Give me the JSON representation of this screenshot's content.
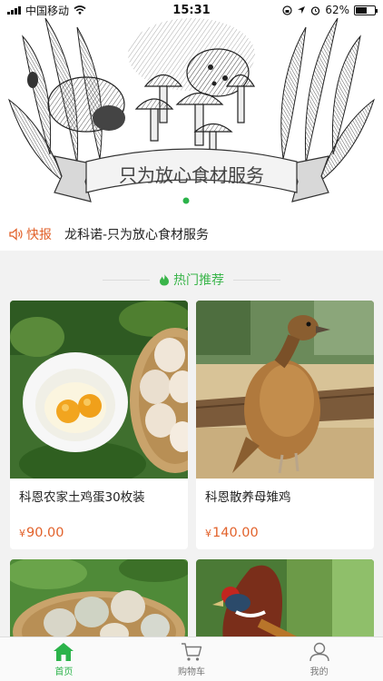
{
  "status_bar": {
    "carrier": "中国移动",
    "time": "15:31",
    "battery": "62%",
    "battery_level": 0.62
  },
  "banner": {
    "slogan": "只为放心食材服务",
    "carousel_current": 1,
    "carousel_total": 1
  },
  "news": {
    "badge": "快报",
    "text": "龙科诺-只为放心食材服务"
  },
  "section": {
    "title": "热门推荐"
  },
  "products": [
    {
      "name": "科恩农家土鸡蛋30枚装",
      "currency": "¥",
      "price": "90.00"
    },
    {
      "name": "科恩散养母雉鸡",
      "currency": "¥",
      "price": "140.00"
    },
    {
      "name": "",
      "currency": "",
      "price": ""
    },
    {
      "name": "",
      "currency": "",
      "price": ""
    }
  ],
  "tabbar": {
    "items": [
      {
        "label": "首页",
        "icon": "home-icon",
        "active": true
      },
      {
        "label": "购物车",
        "icon": "cart-icon",
        "active": false
      },
      {
        "label": "我的",
        "icon": "user-icon",
        "active": false
      }
    ]
  },
  "colors": {
    "accent_green": "#2bb34a",
    "price_orange": "#e2622b"
  }
}
